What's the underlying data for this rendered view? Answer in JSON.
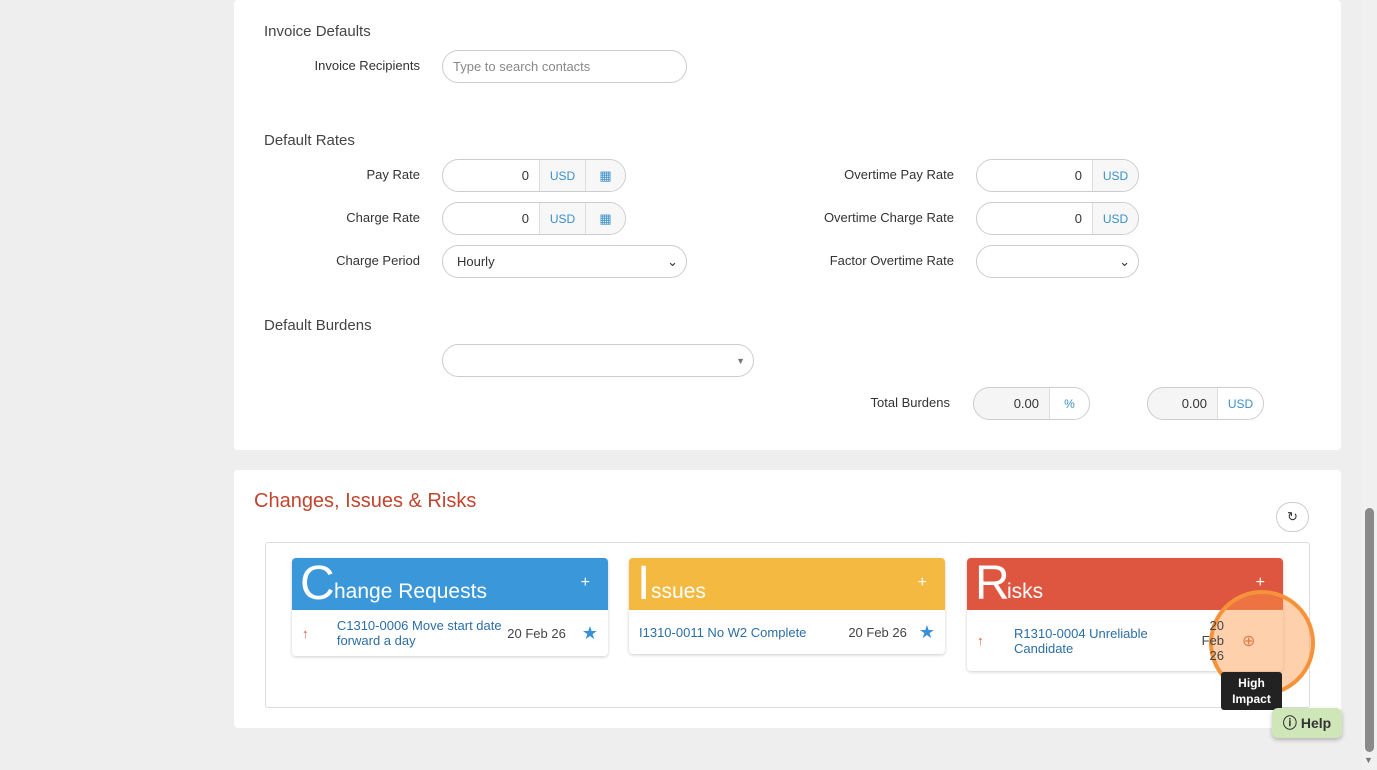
{
  "invoice": {
    "title": "Invoice Defaults",
    "recipients_label": "Invoice Recipients",
    "recipients_placeholder": "Type to search contacts"
  },
  "rates": {
    "title": "Default Rates",
    "pay_rate_label": "Pay Rate",
    "pay_rate": "0",
    "charge_rate_label": "Charge Rate",
    "charge_rate": "0",
    "charge_period_label": "Charge Period",
    "charge_period": "Hourly",
    "ot_pay_label": "Overtime Pay Rate",
    "ot_pay": "0",
    "ot_charge_label": "Overtime Charge Rate",
    "ot_charge": "0",
    "factor_label": "Factor Overtime Rate",
    "factor": "",
    "currency": "USD"
  },
  "burdens": {
    "title": "Default Burdens",
    "total_label": "Total Burdens",
    "percent": "0.00",
    "percent_unit": "%",
    "amount": "0.00",
    "amount_unit": "USD"
  },
  "cir": {
    "title": "Changes, Issues & Risks",
    "panels": [
      {
        "initial": "C",
        "rest": "hange Requests",
        "color": "#3a97d9",
        "item": "C1310-0006 Move start date forward a day",
        "date": "20 Feb 26"
      },
      {
        "initial": "I",
        "rest": "ssues",
        "color": "#f3b941",
        "item": "I1310-0011 No W2 Complete",
        "date": "20 Feb 26"
      },
      {
        "initial": "R",
        "rest": "isks",
        "color": "#df5640",
        "item": "R1310-0004 Unreliable Candidate",
        "date": "20 Feb 26"
      }
    ],
    "tooltip": "High Impact"
  },
  "help": "Help"
}
